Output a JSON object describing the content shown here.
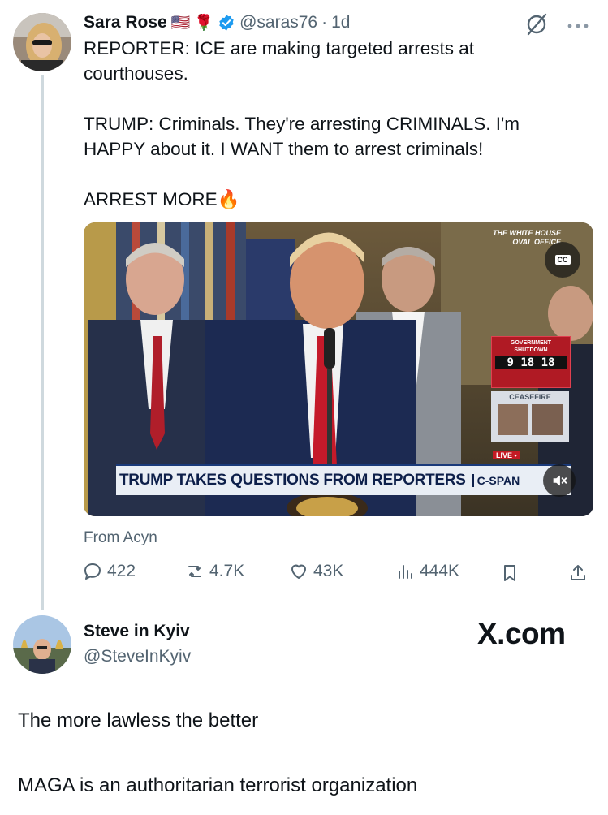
{
  "tweet1": {
    "author_name": "Sara Rose",
    "flag_emoji": "🇺🇸",
    "rose_emoji": "🌹",
    "handle": "@saras76",
    "separator": "·",
    "time": "1d",
    "paragraphs": [
      "REPORTER: ICE are making targeted arrests at\ncourthouses.",
      "TRUMP: Criminals. They're arresting CRIMINALS. I'm\nHAPPY about it. I WANT them to arrest criminals!",
      "ARREST MORE"
    ],
    "fire_emoji": "🔥",
    "video": {
      "chyron": "TRUMP TAKES QUESTIONS FROM REPORTERS",
      "network": "C-SPAN",
      "bug_line1": "THE WHITE HOUSE",
      "bug_line2": "OVAL OFFICE",
      "cc_label": "CC",
      "shutdown_label1": "GOVERNMENT",
      "shutdown_label2": "SHUTDOWN",
      "clock": "9 18 18",
      "ceasefire": "CEASEFIRE",
      "live_label": "LIVE •"
    },
    "source": "From Acyn",
    "stats": {
      "replies": "422",
      "reposts": "4.7K",
      "likes": "43K",
      "views": "444K"
    },
    "icons": [
      "verified-badge-icon",
      "grok-icon",
      "more-icon",
      "reply-icon",
      "repost-icon",
      "like-icon",
      "views-icon",
      "bookmark-icon",
      "share-icon"
    ],
    "colors": {
      "verified": "#1d9bf0",
      "secondary_text": "#536471",
      "thread_line": "#cfd9de"
    }
  },
  "tweet2": {
    "author_name": "Steve in Kyiv",
    "handle": "@SteveInKyiv",
    "watermark": "X.com",
    "paragraphs": [
      "The more lawless the better",
      "MAGA is an authoritarian terrorist organization"
    ]
  }
}
